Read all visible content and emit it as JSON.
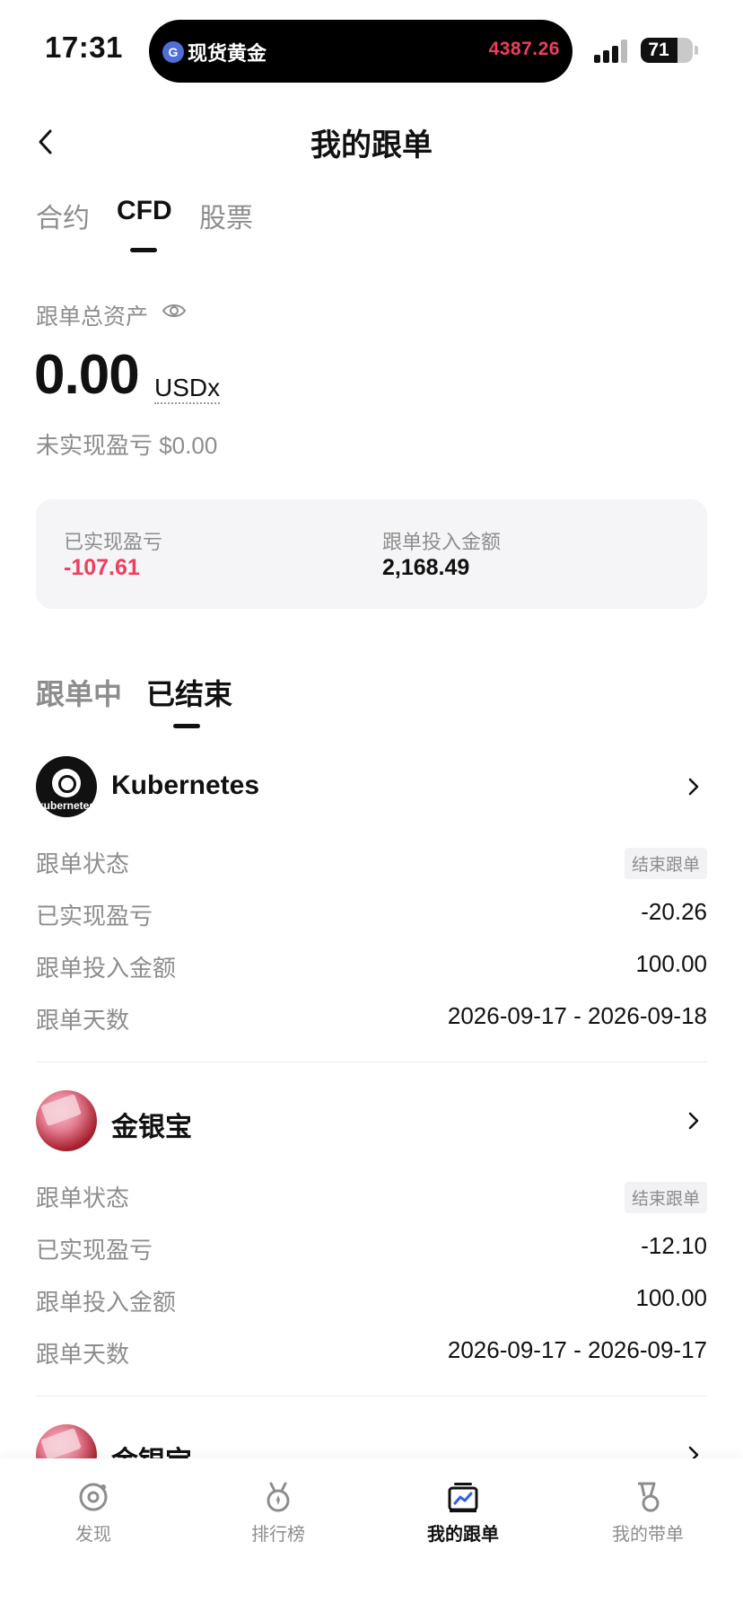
{
  "status_bar": {
    "time": "17:31",
    "island_label": "现货黄金",
    "island_price": "4387.26",
    "battery": "71",
    "battery_level": 0.71
  },
  "header": {
    "title": "我的跟单",
    "back_icon": "chevron-left-icon"
  },
  "top_tabs": [
    {
      "label": "合约",
      "active": false
    },
    {
      "label": "CFD",
      "active": true
    },
    {
      "label": "股票",
      "active": false
    }
  ],
  "assets": {
    "label": "跟单总资产",
    "eye_icon": "eye-icon",
    "value": "0.00",
    "unit": "USDx",
    "unrealized": "未实现盈亏 $0.00"
  },
  "summary": {
    "realized_label": "已实现盈亏",
    "realized_value": "-107.61",
    "invested_label": "跟单投入金额",
    "invested_value": "2,168.49"
  },
  "section_tabs": [
    {
      "label": "跟单中",
      "active": false
    },
    {
      "label": "已结束",
      "active": true
    }
  ],
  "records": [
    {
      "name": "Kubernetes",
      "avatar_text": "kubernetes",
      "rows": {
        "status_label": "跟单状态",
        "status_value": "结束跟单",
        "pnl_label": "已实现盈亏",
        "pnl_value": "-20.26",
        "amount_label": "跟单投入金额",
        "amount_value": "100.00",
        "days_label": "跟单天数",
        "days_value": "2026-09-17 - 2026-09-18"
      }
    },
    {
      "name": "金银宝",
      "rows": {
        "status_label": "跟单状态",
        "status_value": "结束跟单",
        "pnl_label": "已实现盈亏",
        "pnl_value": "-12.10",
        "amount_label": "跟单投入金额",
        "amount_value": "100.00",
        "days_label": "跟单天数",
        "days_value": "2026-09-17 - 2026-09-17"
      }
    },
    {
      "name": "金银宝"
    }
  ],
  "bottom_nav": [
    {
      "label": "发现",
      "icon": "discover-icon",
      "active": false
    },
    {
      "label": "排行榜",
      "icon": "ranking-medal-icon",
      "active": false
    },
    {
      "label": "我的跟单",
      "icon": "my-follow-chart-icon",
      "active": true
    },
    {
      "label": "我的带单",
      "icon": "my-lead-badge-icon",
      "active": false
    }
  ],
  "colors": {
    "negative": "#ee3f5b",
    "muted": "#8d8d8d",
    "card_bg": "#f5f5f7"
  }
}
